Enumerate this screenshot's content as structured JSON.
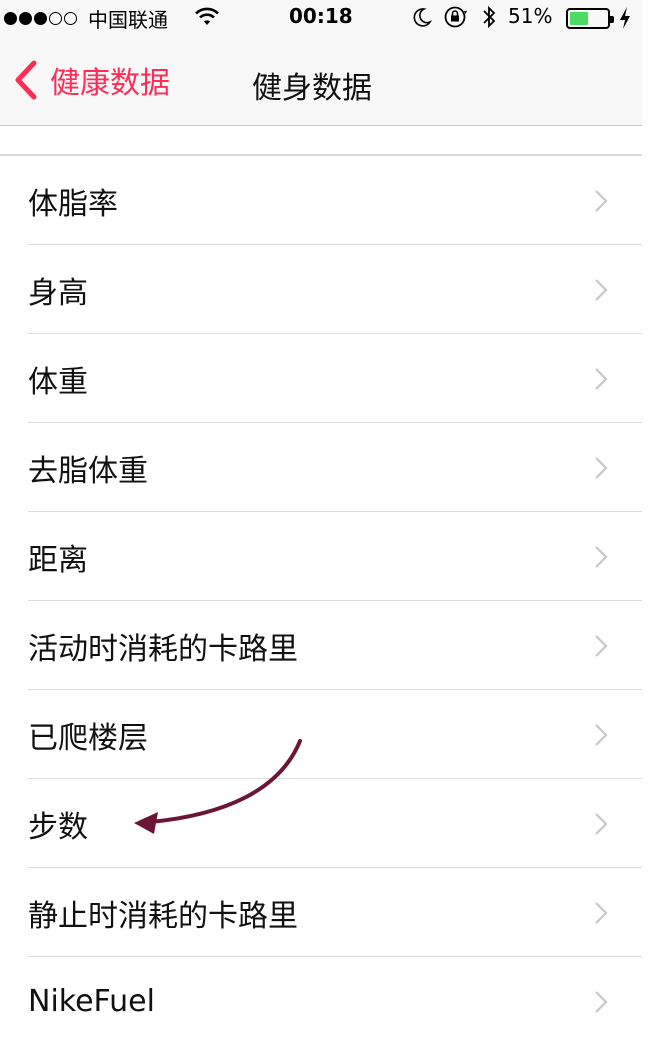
{
  "status_bar": {
    "carrier": "中国联通",
    "time": "00:18",
    "battery_percent": "51%",
    "battery_level": 0.51,
    "signal_bars": 3,
    "signal_total": 5
  },
  "nav": {
    "back_label": "健康数据",
    "title": "健身数据"
  },
  "colors": {
    "accent": "#ff2d55",
    "battery": "#4cd964",
    "annotation_arrow": "#6b1636"
  },
  "icons": {
    "back": "chevron-left-icon",
    "row": "chevron-right-icon",
    "wifi": "wifi-icon",
    "moon": "moon-icon",
    "lock": "rotation-lock-icon",
    "bluetooth": "bluetooth-icon",
    "charging": "bolt-icon"
  },
  "list": {
    "items": [
      {
        "label": "体脂率"
      },
      {
        "label": "身高"
      },
      {
        "label": "体重"
      },
      {
        "label": "去脂体重"
      },
      {
        "label": "距离"
      },
      {
        "label": "活动时消耗的卡路里"
      },
      {
        "label": "已爬楼层"
      },
      {
        "label": "步数"
      },
      {
        "label": "静止时消耗的卡路里"
      },
      {
        "label": "NikeFuel"
      }
    ]
  }
}
